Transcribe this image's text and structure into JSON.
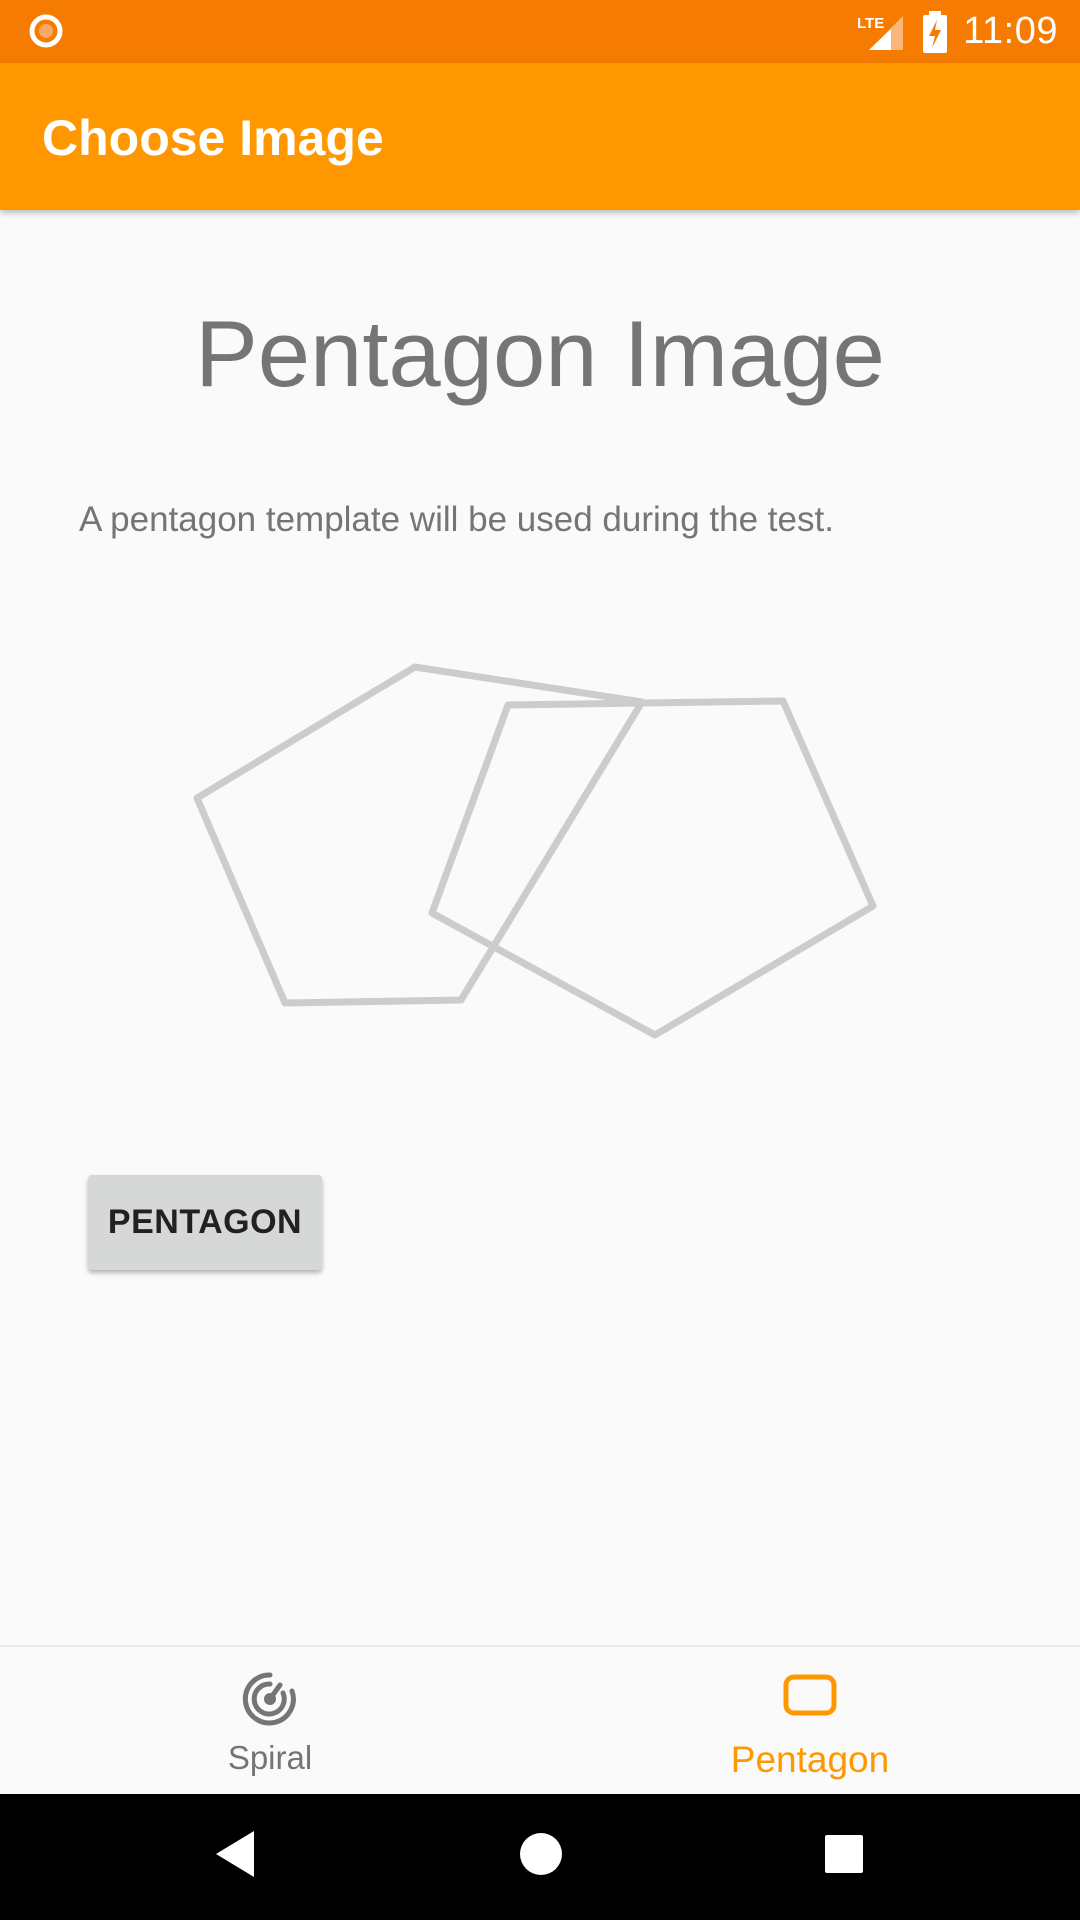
{
  "status_bar": {
    "time": "11:09",
    "network_label": "LTE",
    "icons": [
      "notification-dot-icon",
      "lte-signal-icon",
      "battery-charging-icon"
    ]
  },
  "app_bar": {
    "title": "Choose Image"
  },
  "main": {
    "heading": "Pentagon Image",
    "description": "A pentagon template will be used during the test.",
    "illustration_icon": "overlapping-pentagons-icon",
    "button_label": "PENTAGON"
  },
  "bottom_nav": {
    "items": [
      {
        "label": "Spiral",
        "icon": "spiral-icon",
        "selected": false
      },
      {
        "label": "Pentagon",
        "icon": "pentagon-shape-icon",
        "selected": true
      }
    ],
    "active_color": "#ff9800",
    "inactive_color": "#757575"
  },
  "system_nav": {
    "buttons": [
      "back-icon",
      "home-icon",
      "recents-icon"
    ]
  },
  "colors": {
    "status_bar": "#f57c00",
    "app_bar": "#ff9800",
    "background": "#fafafa"
  }
}
